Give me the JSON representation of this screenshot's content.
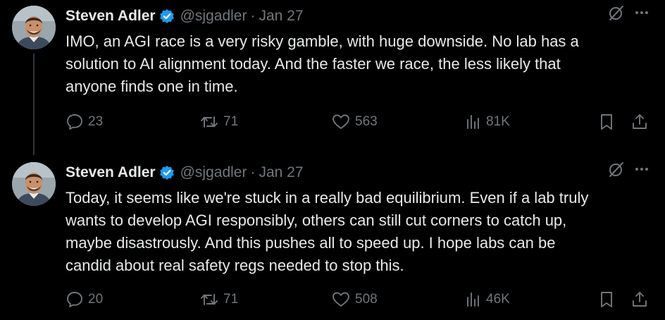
{
  "tweets": [
    {
      "author": "Steven Adler",
      "handle": "@sjgadler",
      "separator": "·",
      "date": "Jan 27",
      "text": "IMO, an AGI race is a very risky gamble, with huge downside. No lab has a\nsolution to AI alignment today. And the faster we race, the less likely that\nanyone finds one in time.",
      "replies": "23",
      "reposts": "71",
      "likes": "563",
      "views": "81K"
    },
    {
      "author": "Steven Adler",
      "handle": "@sjgadler",
      "separator": "·",
      "date": "Jan 27",
      "text": "Today, it seems like we're stuck in a really bad equilibrium. Even if a lab truly\nwants to develop AGI responsibly, others can still cut corners to catch up,\nmaybe disastrously. And this pushes all to speed up. I hope labs can be\ncandid about real safety regs needed to stop this.",
      "replies": "20",
      "reposts": "71",
      "likes": "508",
      "views": "46K"
    }
  ],
  "icons": {
    "verified": "verified-badge-icon",
    "grok": "grok-icon",
    "more": "more-icon",
    "reply": "reply-icon",
    "repost": "repost-icon",
    "like": "heart-icon",
    "views": "views-icon",
    "bookmark": "bookmark-icon",
    "share": "share-icon"
  },
  "colors": {
    "background": "#000000",
    "text": "#e7e9ea",
    "muted": "#71767b",
    "verified": "#1d9bf0",
    "thread_line": "#333639"
  }
}
